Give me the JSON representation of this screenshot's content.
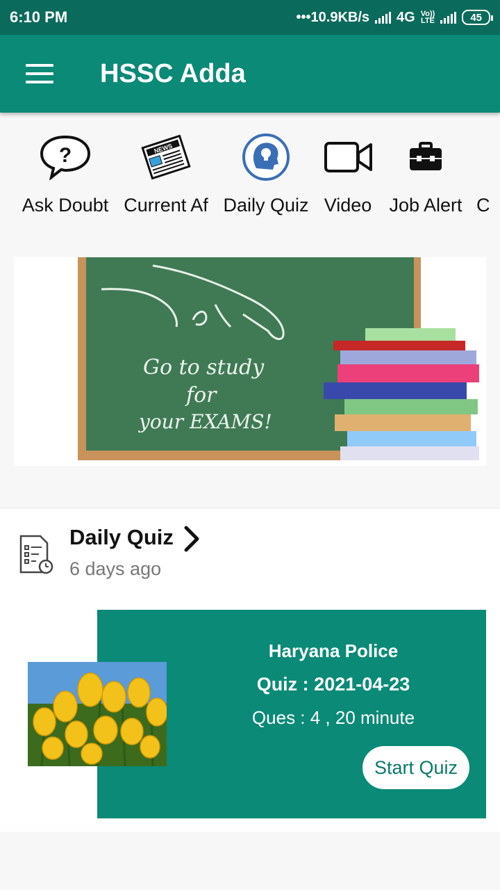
{
  "status_bar": {
    "time": "6:10 PM",
    "network": "•••10.9KB/s",
    "net_type": "4G",
    "volte_top": "Vo))",
    "volte_bottom": "LTE",
    "battery": "45"
  },
  "app_bar": {
    "title": "HSSC Adda",
    "menu_icon": "hamburger-menu-icon"
  },
  "categories": [
    {
      "label": "Ask Doubt",
      "icon": "question-bubble-icon"
    },
    {
      "label": "Current Af",
      "icon": "newspaper-icon"
    },
    {
      "label": "Daily Quiz",
      "icon": "lightbulb-head-icon"
    },
    {
      "label": "Video",
      "icon": "video-camera-icon"
    },
    {
      "label": "Job Alert",
      "icon": "briefcase-icon"
    },
    {
      "label": "C",
      "icon": ""
    }
  ],
  "banner": {
    "lines": [
      "Go to study",
      "for",
      "your EXAMS!"
    ],
    "colors": {
      "board": "#3f7a55",
      "frame": "#c8935a"
    }
  },
  "quiz_section": {
    "title": "Daily Quiz",
    "time_ago": "6 days ago",
    "card": {
      "line1": "Haryana Police",
      "line2": "Quiz : 2021-04-23",
      "line3": "Ques : 4 , 20 minute",
      "button": "Start Quiz"
    }
  },
  "colors": {
    "primary": "#0a8a77",
    "status_bar": "#0a6b5c",
    "button_text": "#0a7a69"
  }
}
